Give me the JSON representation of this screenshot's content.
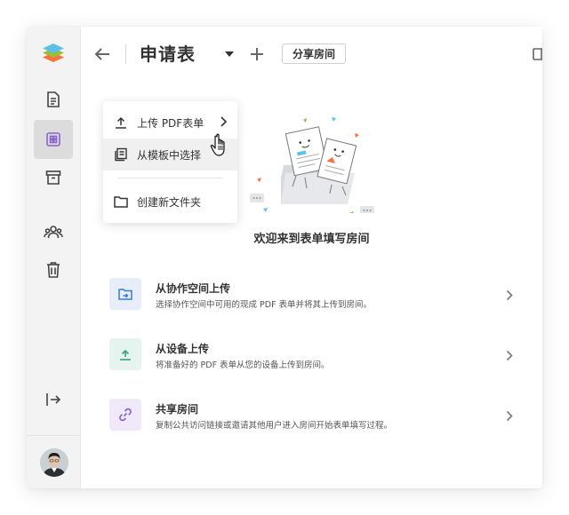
{
  "app": {
    "colors": {
      "accent_purple": "#8a63d2",
      "upload_green": "#3aa17e",
      "workspace_blue": "#3a7bd5",
      "sidebar_bg": "#f3f3f3",
      "active_bg": "#dcdcdc"
    }
  },
  "sidebar": {
    "items": [
      {
        "name": "logo-icon",
        "icon": "layers-logo"
      },
      {
        "name": "documents-icon",
        "icon": "document"
      },
      {
        "name": "rooms-icon",
        "icon": "grid",
        "active": true
      },
      {
        "name": "archive-icon",
        "icon": "archive"
      },
      {
        "name": "contacts-icon",
        "icon": "people"
      },
      {
        "name": "trash-icon",
        "icon": "trash"
      },
      {
        "name": "logout-icon",
        "icon": "arrow-to-right"
      }
    ]
  },
  "header": {
    "title": "申请表",
    "share_label": "分享房间"
  },
  "dropdown": {
    "items": [
      {
        "label": "上传 PDF表单",
        "icon": "upload-icon",
        "has_submenu": true
      },
      {
        "label": "从模板中选择",
        "icon": "template-icon",
        "hover": true
      },
      {
        "label": "创建新文件夹",
        "icon": "folder-icon"
      }
    ]
  },
  "main": {
    "welcome": "欢迎来到表单填写房间",
    "options": [
      {
        "title": "从协作空间上传",
        "desc": "选择协作空间中可用的现成 PDF 表单并将其上传到房间。",
        "icon": "workspace-upload-icon"
      },
      {
        "title": "从设备上传",
        "desc": "将准备好的 PDF 表单从您的设备上传到房间。",
        "icon": "device-upload-icon"
      },
      {
        "title": "共享房间",
        "desc": "复制公共访问链接或邀请其他用户进入房间开始表单填写过程。",
        "icon": "link-icon"
      }
    ]
  }
}
